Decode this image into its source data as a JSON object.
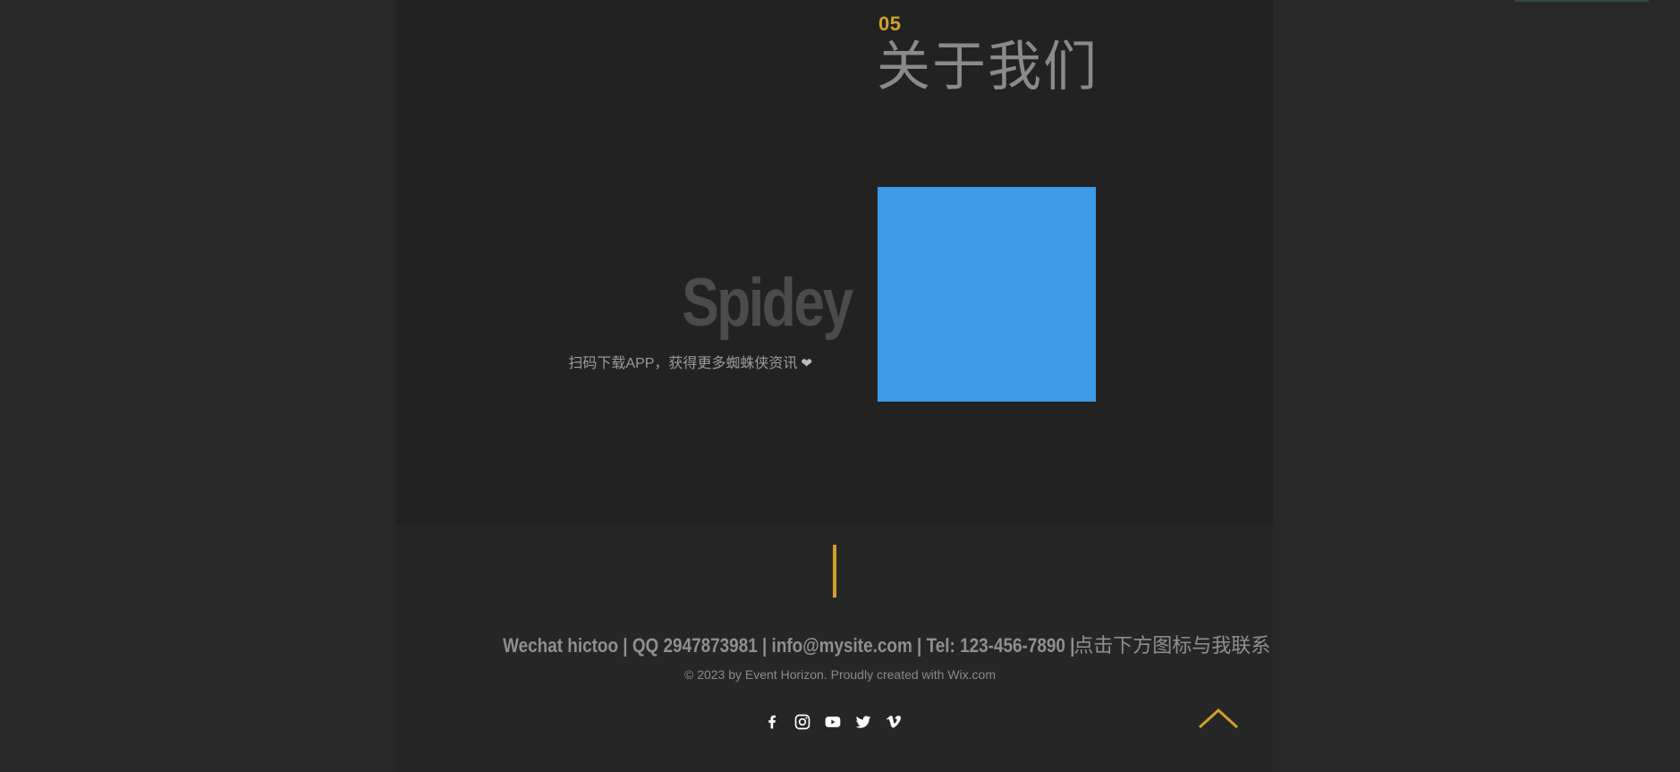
{
  "about": {
    "number": "05",
    "title": "关于我们"
  },
  "app_promo": {
    "logo_text": "Spidey",
    "caption": "扫码下载APP，获得更多蜘蛛侠资讯",
    "caption_icon": "heart-icon",
    "qr_color": "#3d9ae8"
  },
  "footer": {
    "contact_en": "Wechat hictoo | QQ 2947873981 | info@mysite.com | Tel: 123-456-7890 |",
    "contact_cn": "点击下方图标与我联系",
    "copyright": "© 2023 by Event Horizon. Proudly created with Wix.com",
    "social_icons": [
      "facebook-icon",
      "instagram-icon",
      "youtube-icon",
      "twitter-icon",
      "vimeo-icon"
    ],
    "back_to_top_icon": "chevron-up-icon"
  },
  "colors": {
    "accent": "#d2a02a",
    "panel": "#222222",
    "background": "#282828",
    "text_muted": "#8f8f8f"
  }
}
